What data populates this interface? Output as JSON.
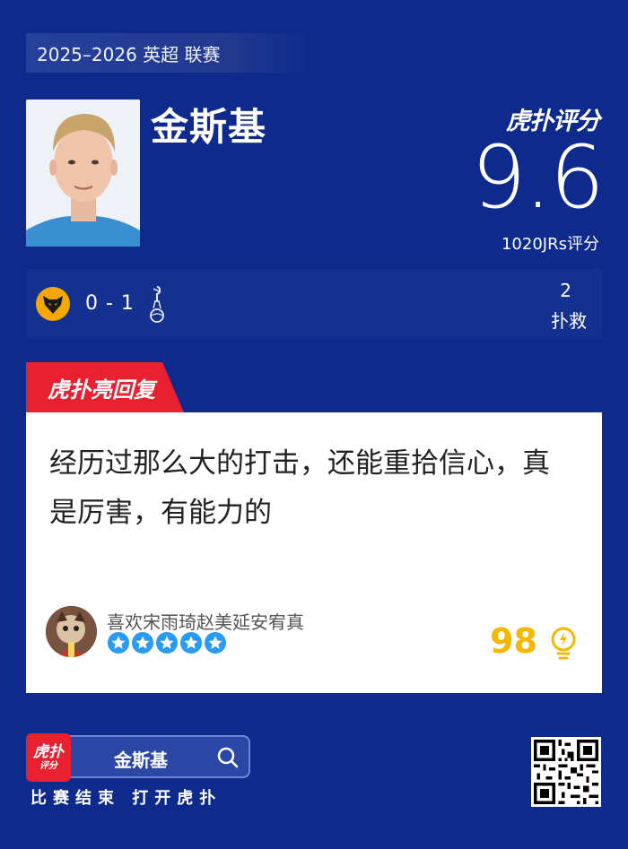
{
  "season": "2025–2026 英超 联赛",
  "player": {
    "name": "金斯基"
  },
  "rating": {
    "logo": "虎扑评分",
    "score": "9.6",
    "votes": "1020JRs评分"
  },
  "match": {
    "home_team_icon": "wolves-crest-icon",
    "away_team_icon": "spurs-crest-icon",
    "score": "0 - 1",
    "stat_value": "2",
    "stat_label": "扑救"
  },
  "comment": {
    "tag": "虎扑亮回复",
    "text": "经历过那么大的打击，还能重拾信心，真是厉害，有能力的",
    "username": "喜欢宋雨琦赵美延安宥真",
    "star_count": 5,
    "likes": "98"
  },
  "footer": {
    "logo_line1": "虎扑",
    "logo_line2": "评分",
    "search_text": "金斯基",
    "caption": "比赛结束 打开虎扑"
  },
  "colors": {
    "background": "#0d2a8c",
    "accent_red": "#e8202f",
    "likes_gold": "#f5b700",
    "star_blue": "#2a9bf4"
  }
}
